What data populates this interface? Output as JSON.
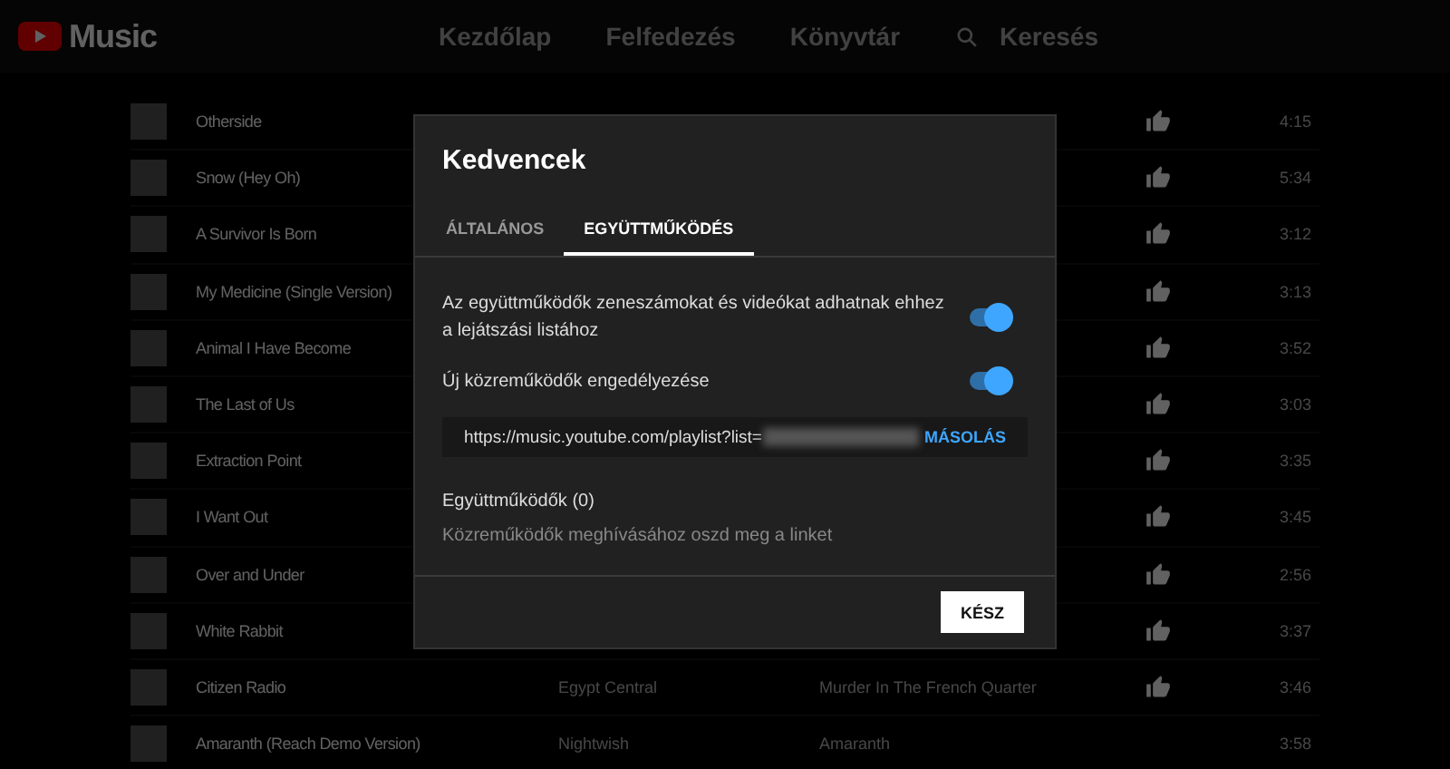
{
  "header": {
    "logo": "Music",
    "nav": [
      {
        "label": "Kezdőlap",
        "selected": false
      },
      {
        "label": "Felfedezés",
        "selected": false
      },
      {
        "label": "Könyvtár",
        "selected": false
      }
    ],
    "search": "Keresés"
  },
  "songs": [
    {
      "title": "Otherside",
      "liked": true,
      "duration": "4:15"
    },
    {
      "title": "Snow (Hey Oh)",
      "liked": true,
      "duration": "5:34"
    },
    {
      "title": "A Survivor Is Born",
      "liked": true,
      "duration": "3:12"
    },
    {
      "title": "My Medicine (Single Version)",
      "liked": true,
      "duration": "3:13"
    },
    {
      "title": "Animal I Have Become",
      "liked": true,
      "duration": "3:52"
    },
    {
      "title": "The Last of Us",
      "liked": true,
      "duration": "3:03"
    },
    {
      "title": "Extraction Point",
      "liked": true,
      "duration": "3:35"
    },
    {
      "title": "I Want Out",
      "liked": true,
      "duration": "3:45"
    },
    {
      "title": "Over and Under",
      "liked": true,
      "duration": "2:56"
    },
    {
      "title": "White Rabbit",
      "liked": true,
      "duration": "3:37"
    },
    {
      "title": "Citizen Radio",
      "artist": "Egypt Central",
      "album": "Murder In The French Quarter",
      "liked": true,
      "duration": "3:46"
    },
    {
      "title": "Amaranth (Reach Demo Version)",
      "artist": "Nightwish",
      "album": "Amaranth",
      "liked": false,
      "duration": "3:58"
    }
  ],
  "dialog": {
    "title": "Kedvencek",
    "tabs": [
      {
        "label": "ÁLTALÁNOS",
        "selected": false
      },
      {
        "label": "EGYÜTTMŰKÖDÉS",
        "selected": true
      }
    ],
    "settings": [
      {
        "label": "Az együttműködők zeneszámokat és videókat adhatnak ehhez a lejátszási listához",
        "on": true
      },
      {
        "label": "Új közreműködők engedélyezése",
        "on": true
      }
    ],
    "link": {
      "url": "https://music.youtube.com/playlist?list=",
      "redacted": true,
      "copy": "MÁSOLÁS"
    },
    "collaborators_title": "Együttműködők (0)",
    "collaborators_hint": "Közreműködők meghívásához oszd meg a linket",
    "done": "KÉSZ"
  }
}
